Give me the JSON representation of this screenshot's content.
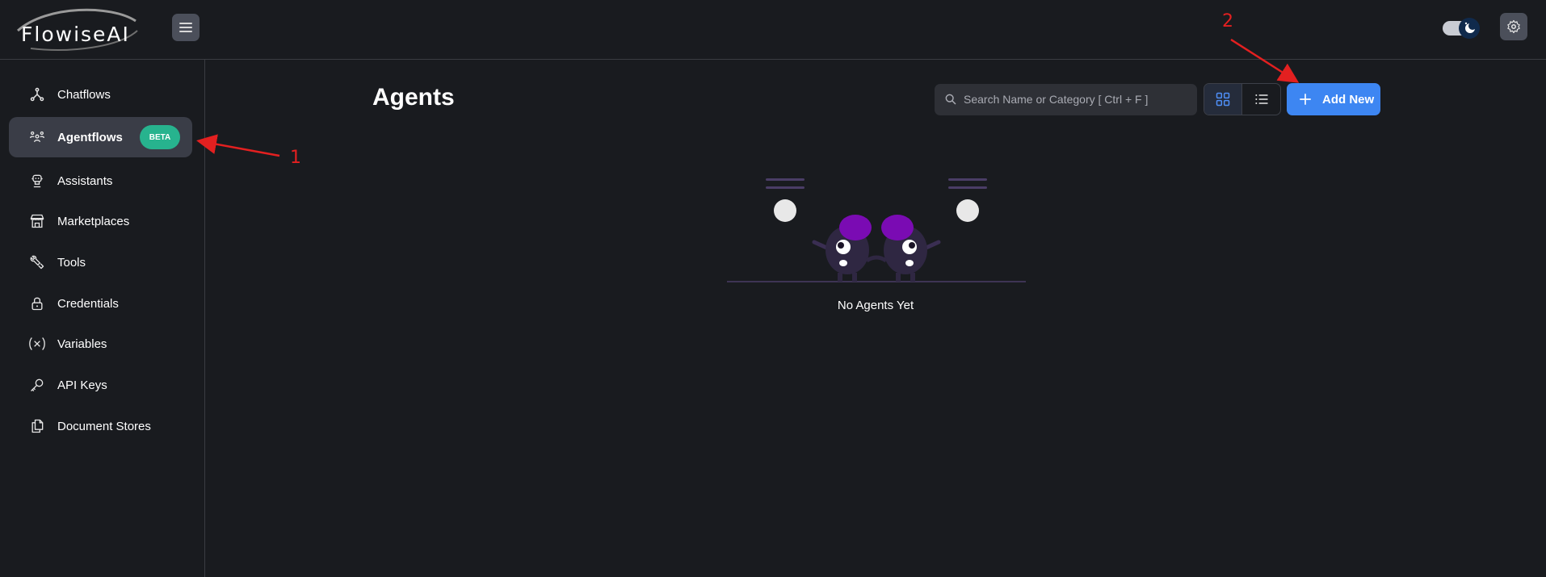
{
  "app": {
    "logo_text": "FlowiseAI"
  },
  "sidebar": {
    "items": [
      {
        "label": "Chatflows",
        "icon": "hierarchy-icon"
      },
      {
        "label": "Agentflows",
        "icon": "users-group-icon",
        "badge": "BETA",
        "active": true
      },
      {
        "label": "Assistants",
        "icon": "robot-icon"
      },
      {
        "label": "Marketplaces",
        "icon": "building-store-icon"
      },
      {
        "label": "Tools",
        "icon": "tool-icon"
      },
      {
        "label": "Credentials",
        "icon": "lock-icon"
      },
      {
        "label": "Variables",
        "icon": "variable-icon"
      },
      {
        "label": "API Keys",
        "icon": "key-icon"
      },
      {
        "label": "Document Stores",
        "icon": "files-icon"
      }
    ]
  },
  "main": {
    "title": "Agents",
    "search_placeholder": "Search Name or Category [ Ctrl + F ]",
    "add_button": "Add New",
    "empty_text": "No Agents Yet"
  },
  "annotations": {
    "marker_1": "1",
    "marker_2": "2",
    "color": "#e32020"
  },
  "colors": {
    "accent": "#3d86f2",
    "badge": "#27b38e",
    "background": "#191b1f"
  }
}
